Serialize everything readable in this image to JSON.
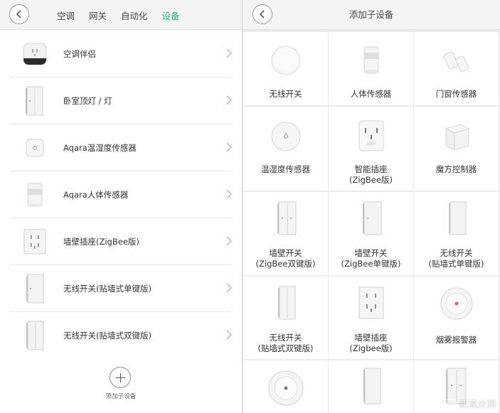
{
  "left_panel": {
    "tabs": [
      {
        "label": "空调",
        "active": false
      },
      {
        "label": "网关",
        "active": false
      },
      {
        "label": "自动化",
        "active": false
      },
      {
        "label": "设备",
        "active": true
      }
    ],
    "accent_color": "#23b47a",
    "devices": [
      {
        "name": "空调伴侣",
        "icon": "ac-companion-icon"
      },
      {
        "name": "卧室顶灯 / 灯",
        "icon": "wall-switch-icon"
      },
      {
        "name": "Aqara温湿度传感器",
        "icon": "temp-humidity-sensor-icon"
      },
      {
        "name": "Aqara人体传感器",
        "icon": "motion-sensor-icon"
      },
      {
        "name": "墙壁插座(ZigBee版)",
        "icon": "wall-outlet-icon"
      },
      {
        "name": "无线开关(贴墙式单键版)",
        "icon": "single-switch-icon"
      },
      {
        "name": "无线开关(贴墙式双键版)",
        "icon": "double-switch-icon"
      }
    ],
    "add_label": "添加子设备"
  },
  "right_panel": {
    "title": "添加子设备",
    "items": [
      {
        "lines": [
          "无线开关"
        ],
        "icon": "wireless-button-icon"
      },
      {
        "lines": [
          "人体传感器"
        ],
        "icon": "motion-sensor-icon"
      },
      {
        "lines": [
          "门窗传感器"
        ],
        "icon": "door-window-sensor-icon"
      },
      {
        "lines": [
          "温湿度传感器"
        ],
        "icon": "temp-humidity-sensor-icon"
      },
      {
        "lines": [
          "智能插座",
          "(ZigBee版)"
        ],
        "icon": "smart-plug-icon"
      },
      {
        "lines": [
          "魔方控制器"
        ],
        "icon": "magic-cube-icon"
      },
      {
        "lines": [
          "墙壁开关",
          "(ZigBee双键版)"
        ],
        "icon": "wall-double-switch-icon"
      },
      {
        "lines": [
          "墙壁开关",
          "(ZigBee单键版)"
        ],
        "icon": "wall-single-switch-icon"
      },
      {
        "lines": [
          "无线开关",
          "(贴墙式单键版)"
        ],
        "icon": "wireless-single-switch-icon"
      },
      {
        "lines": [
          "无线开关",
          "(贴墙式双键版)"
        ],
        "icon": "wireless-double-switch-icon"
      },
      {
        "lines": [
          "墙壁插座",
          "(Zigbee版)"
        ],
        "icon": "wall-outlet-icon"
      },
      {
        "lines": [
          "烟雾报警器"
        ],
        "icon": "smoke-alarm-icon"
      },
      {
        "lines": [],
        "icon": "gas-alarm-icon"
      },
      {
        "lines": [],
        "icon": "wall-switch-icon"
      },
      {
        "lines": [],
        "icon": "wall-double-switch-icon"
      }
    ]
  },
  "watermark": "新浪众测"
}
